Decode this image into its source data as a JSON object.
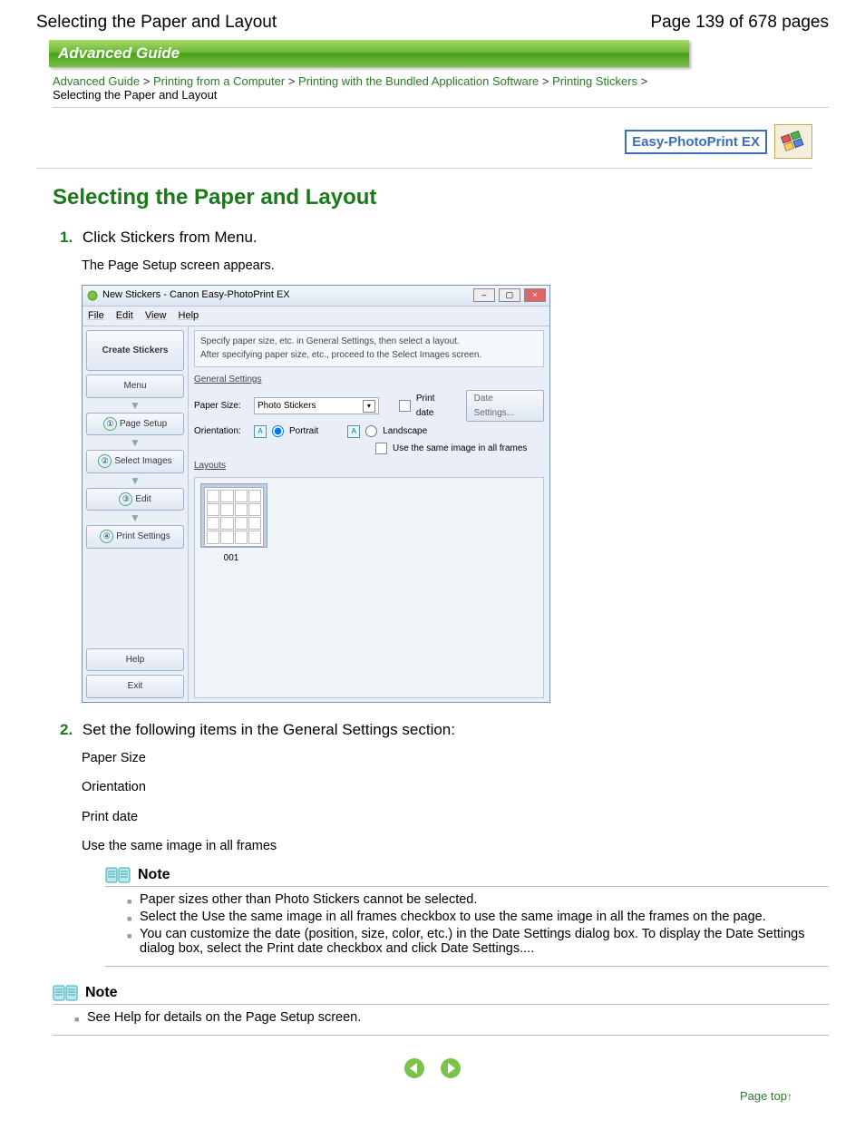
{
  "header": {
    "title_left": "Selecting the Paper and Layout",
    "page_indicator": "Page 139 of 678 pages"
  },
  "banner": "Advanced Guide",
  "breadcrumb": {
    "items": [
      "Advanced Guide",
      "Printing from a Computer",
      "Printing with the Bundled Application Software",
      "Printing Stickers"
    ],
    "current": "Selecting the Paper and Layout"
  },
  "badge": {
    "text": "Easy-PhotoPrint EX"
  },
  "section_title": "Selecting the Paper and Layout",
  "steps": [
    {
      "num": "1.",
      "head": "Click Stickers from Menu.",
      "sub": "The Page Setup screen appears."
    },
    {
      "num": "2.",
      "head": "Set the following items in the General Settings section:",
      "items": [
        "Paper Size",
        "Orientation",
        "Print date",
        "Use the same image in all frames"
      ]
    }
  ],
  "app": {
    "title": "New Stickers - Canon Easy-PhotoPrint EX",
    "menubar": [
      "File",
      "Edit",
      "View",
      "Help"
    ],
    "side": {
      "create": "Create Stickers",
      "menu": "Menu",
      "step1": "Page Setup",
      "step2": "Select Images",
      "step3": "Edit",
      "step4": "Print Settings",
      "help": "Help",
      "exit": "Exit"
    },
    "hint1": "Specify paper size, etc. in General Settings, then select a layout.",
    "hint2": "After specifying paper size, etc., proceed to the Select Images screen.",
    "general_label": "General Settings",
    "paper_size_label": "Paper Size:",
    "paper_size_value": "Photo Stickers",
    "orientation_label": "Orientation:",
    "portrait": "Portrait",
    "landscape": "Landscape",
    "print_date": "Print date",
    "date_settings": "Date Settings...",
    "same_image": "Use the same image in all frames",
    "layouts_label": "Layouts",
    "thumb_label": "001"
  },
  "notes": {
    "heading": "Note",
    "inner": [
      "Paper sizes other than Photo Stickers cannot be selected.",
      "Select the Use the same image in all frames checkbox to use the same image in all the frames on the page.",
      "You can customize the date (position, size, color, etc.) in the Date Settings dialog box. To display the Date Settings dialog box, select the Print date checkbox and click Date Settings...."
    ],
    "outer": [
      "See Help for details on the Page Setup screen."
    ]
  },
  "page_top": "Page top"
}
